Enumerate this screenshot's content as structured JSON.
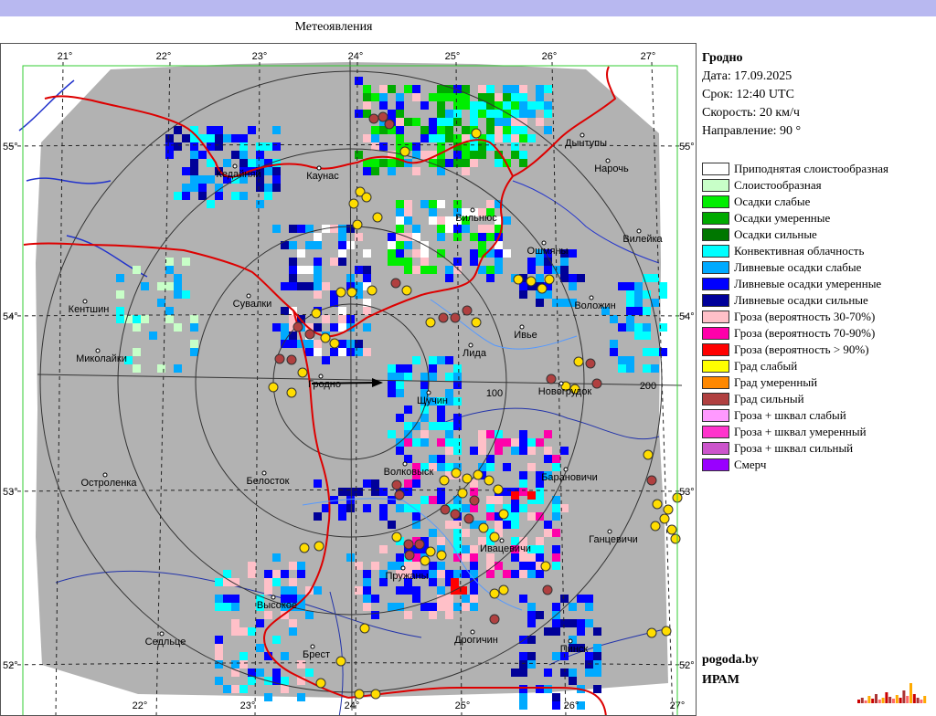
{
  "window_title": "Метеоявления",
  "station": "Гродно",
  "info": {
    "date": "Дата: 17.09.2025",
    "time": "Срок: 12:40 UTC",
    "speed": "Скорость: 20  км/ч",
    "direction": "Направление:  90 °"
  },
  "legend": [
    {
      "label": "Приподнятая слоистообразная",
      "color": "#ffffff"
    },
    {
      "label": "Слоистообразная",
      "color": "#c8ffc8"
    },
    {
      "label": "Осадки слабые",
      "color": "#00ee00"
    },
    {
      "label": "Осадки умеренные",
      "color": "#00aa00"
    },
    {
      "label": "Осадки сильные",
      "color": "#007700"
    },
    {
      "label": "Конвективная облачность",
      "color": "#00ffff"
    },
    {
      "label": "Ливневые осадки слабые",
      "color": "#00aaff"
    },
    {
      "label": "Ливневые осадки умеренные",
      "color": "#0000ff"
    },
    {
      "label": "Ливневые осадки сильные",
      "color": "#000099"
    },
    {
      "label": "Гроза (вероятность 30-70%)",
      "color": "#ffc0c8"
    },
    {
      "label": "Гроза (вероятность 70-90%)",
      "color": "#ff00aa"
    },
    {
      "label": "Гроза (вероятность > 90%)",
      "color": "#ff0000"
    },
    {
      "label": "Град слабый",
      "color": "#ffff00"
    },
    {
      "label": "Град умеренный",
      "color": "#ff8800"
    },
    {
      "label": "Град сильный",
      "color": "#b04040"
    },
    {
      "label": "Гроза + шквал слабый",
      "color": "#ff99ff"
    },
    {
      "label": "Гроза + шквал умеренный",
      "color": "#ff33cc"
    },
    {
      "label": "Гроза + шквал сильный",
      "color": "#cc55cc"
    },
    {
      "label": "Смерч",
      "color": "#9900ff"
    }
  ],
  "credits": [
    "pogoda.by",
    "ИРАМ"
  ],
  "map": {
    "longitude_labels": [
      "21°",
      "22°",
      "23°",
      "24°",
      "25°",
      "26°",
      "27°"
    ],
    "latitude_labels": [
      "55°",
      "54°",
      "53°",
      "52°"
    ],
    "range_labels": [
      "100",
      "200"
    ],
    "cities": [
      "Кедайняй",
      "Каунас",
      "Вильнюс",
      "Ошмяны",
      "Вилейка",
      "Нарочь",
      "Дынтупы",
      "Сувалки",
      "Кентшин",
      "Миколайки",
      "Лида",
      "Ивье",
      "Воложин",
      "Новогрудок",
      "Гродно",
      "Щучин",
      "Острoленка",
      "Белосток",
      "Волковыск",
      "Барановичи",
      "Ганцевичи",
      "Ивацевичи",
      "Пружаны",
      "Высокое",
      "Брест",
      "Седльце",
      "Дрогичин",
      "Пинск"
    ]
  }
}
